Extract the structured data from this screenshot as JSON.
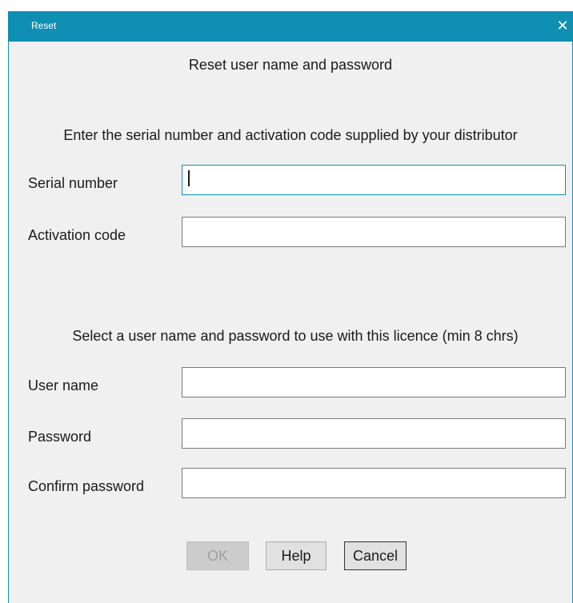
{
  "window": {
    "title": "Reset",
    "close_glyph": "✕"
  },
  "heading": "Reset user name and password",
  "serial_section": {
    "instruction": "Enter the serial number and activation code supplied by your distributor",
    "serial_label": "Serial number",
    "serial_value": "",
    "activation_label": "Activation code",
    "activation_value": ""
  },
  "user_section": {
    "instruction": "Select a user name and password to use with this licence (min 8 chrs)",
    "username_label": "User name",
    "username_value": "",
    "password_label": "Password",
    "password_value": "",
    "confirm_label": "Confirm password",
    "confirm_value": ""
  },
  "buttons": {
    "ok": "OK",
    "help": "Help",
    "cancel": "Cancel"
  },
  "colors": {
    "titlebar": "#0f8fb3",
    "background": "#f0f0f0"
  }
}
